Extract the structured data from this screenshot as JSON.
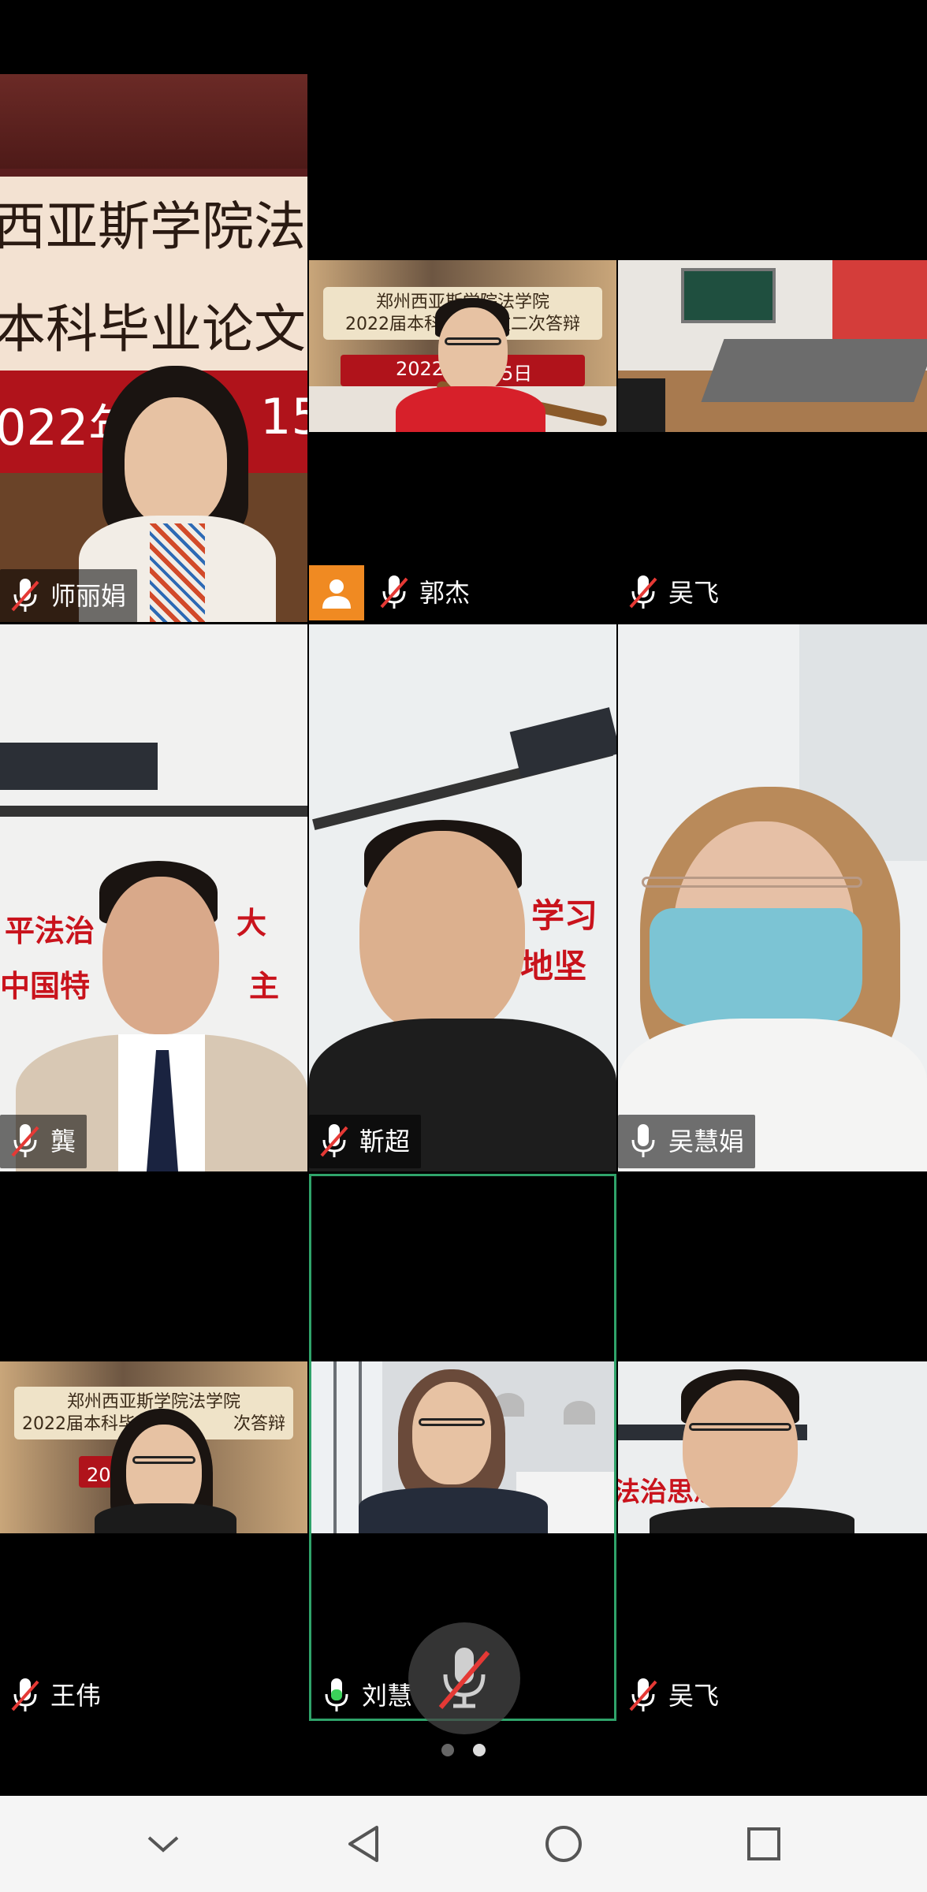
{
  "participants": [
    {
      "name": "师丽娟",
      "mic": "muted"
    },
    {
      "name": "郭杰",
      "mic": "muted",
      "badge": "avatar"
    },
    {
      "name": "吴飞",
      "mic": "muted"
    },
    {
      "name": "龔",
      "mic": "muted"
    },
    {
      "name": "靳超",
      "mic": "muted"
    },
    {
      "name": "吴慧娟",
      "mic": "on"
    },
    {
      "name": "王伟",
      "mic": "muted"
    },
    {
      "name": "刘慧",
      "mic": "active",
      "highlighted": true
    },
    {
      "name": "吴飞",
      "mic": "muted"
    }
  ],
  "video_text": {
    "shi_banner_line1": "西亚斯学院法",
    "shi_banner_line2": "本科毕业论文",
    "shi_banner_line3": "022年",
    "shi_banner_line3b": "15",
    "guo_banner_line1": "郑州西亚斯学院法学院",
    "guo_banner_line2": "2022届本科毕业论文二次答辩",
    "guo_banner_line3": "2022",
    "guo_banner_line3b": "5日",
    "wang_banner_line1": "郑州西亚斯学院法学院",
    "wang_banner_line2": "2022届本科毕",
    "wang_banner_line2b": "次答辩",
    "wang_banner_line3": "2022年",
    "gong_wall_1": "平法治",
    "gong_wall_1b": "大",
    "gong_wall_2": "中国特",
    "gong_wall_2b": "主",
    "jin_wall_1": "学习",
    "jin_wall_2": "地坚",
    "wu2_wall": "法治思想"
  },
  "pager": {
    "pages": 2,
    "current": 2
  },
  "colors": {
    "highlight_border": "#2fa36a",
    "avatar_badge": "#f08a22",
    "mute_red": "#e53935",
    "mic_active_green": "#3bd15a"
  },
  "icons": {
    "mic_muted": "mic-muted-icon",
    "mic_on": "mic-icon",
    "avatar": "person-icon",
    "nav_back": "triangle-back-icon",
    "nav_home": "circle-home-icon",
    "nav_recents": "square-recents-icon",
    "nav_collapse": "chevron-down-icon"
  }
}
